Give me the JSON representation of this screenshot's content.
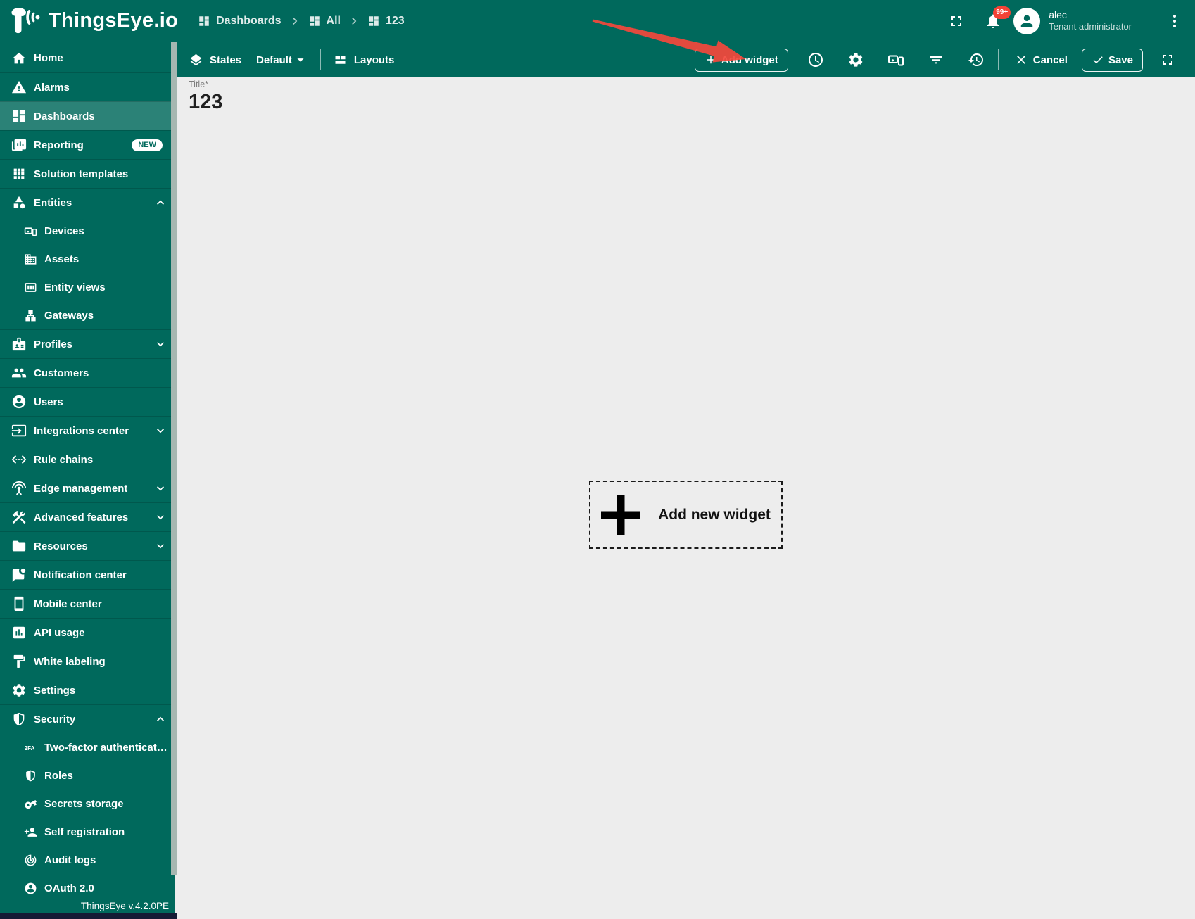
{
  "app": {
    "brand": "ThingsEye.io",
    "version_label": "ThingsEye v.4.2.0PE"
  },
  "colors": {
    "teal": "#00695c",
    "selected_row": "rgba(255,255,255,0.17)",
    "main_bg": "#ededed",
    "notification_badge_red": "#f44336",
    "annotation_arrow_red": "#f4483c",
    "scrollbar_thumb": "#a6b7b1",
    "bottom_strip": "#141b35"
  },
  "topbar": {
    "breadcrumb": [
      {
        "label": "Dashboards",
        "icon": "dashboards-icon"
      },
      {
        "label": "All",
        "icon": "dashboards-icon"
      },
      {
        "label": "123",
        "icon": "dashboards-icon"
      }
    ],
    "notifications_badge": "99+",
    "user": {
      "name": "alec",
      "role": "Tenant administrator"
    }
  },
  "toolbar": {
    "states_label": "States",
    "states_value": "Default",
    "layouts_label": "Layouts",
    "add_widget_label": "Add widget",
    "cancel_label": "Cancel",
    "save_label": "Save",
    "icon_buttons": [
      "time-window-icon",
      "settings-gear-icon",
      "entity-aliases-icon",
      "filter-icon",
      "version-history-icon"
    ]
  },
  "sidebar": {
    "items": [
      {
        "label": "Home",
        "icon": "home-icon",
        "level": "top"
      },
      {
        "label": "Alarms",
        "icon": "alarms-icon",
        "level": "top",
        "divider": true
      },
      {
        "label": "Dashboards",
        "icon": "dashboards-icon",
        "level": "top",
        "divider": true,
        "selected": true
      },
      {
        "label": "Reporting",
        "icon": "reporting-icon",
        "level": "top",
        "divider": true,
        "badge": "NEW"
      },
      {
        "label": "Solution templates",
        "icon": "solution-templates-icon",
        "level": "top",
        "divider": true
      },
      {
        "label": "Entities",
        "icon": "entities-icon",
        "level": "top",
        "divider": true,
        "chevron": "up"
      },
      {
        "label": "Devices",
        "icon": "devices-icon",
        "level": "sub"
      },
      {
        "label": "Assets",
        "icon": "assets-icon",
        "level": "sub"
      },
      {
        "label": "Entity views",
        "icon": "entity-views-icon",
        "level": "sub"
      },
      {
        "label": "Gateways",
        "icon": "gateways-icon",
        "level": "sub"
      },
      {
        "label": "Profiles",
        "icon": "profiles-icon",
        "level": "top",
        "divider": true,
        "chevron": "down"
      },
      {
        "label": "Customers",
        "icon": "customers-icon",
        "level": "top",
        "divider": true
      },
      {
        "label": "Users",
        "icon": "users-icon",
        "level": "top",
        "divider": true
      },
      {
        "label": "Integrations center",
        "icon": "integrations-center-icon",
        "level": "top",
        "divider": true,
        "chevron": "down"
      },
      {
        "label": "Rule chains",
        "icon": "rule-chains-icon",
        "level": "top",
        "divider": true
      },
      {
        "label": "Edge management",
        "icon": "edge-management-icon",
        "level": "top",
        "divider": true,
        "chevron": "down"
      },
      {
        "label": "Advanced features",
        "icon": "advanced-features-icon",
        "level": "top",
        "divider": true,
        "chevron": "down"
      },
      {
        "label": "Resources",
        "icon": "resources-icon",
        "level": "top",
        "divider": true,
        "chevron": "down"
      },
      {
        "label": "Notification center",
        "icon": "notification-center-icon",
        "level": "top",
        "divider": true
      },
      {
        "label": "Mobile center",
        "icon": "mobile-center-icon",
        "level": "top",
        "divider": true
      },
      {
        "label": "API usage",
        "icon": "api-usage-icon",
        "level": "top",
        "divider": true
      },
      {
        "label": "White labeling",
        "icon": "white-labeling-icon",
        "level": "top",
        "divider": true
      },
      {
        "label": "Settings",
        "icon": "settings-icon",
        "level": "top",
        "divider": true
      },
      {
        "label": "Security",
        "icon": "security-icon",
        "level": "top",
        "divider": true,
        "chevron": "up"
      },
      {
        "label": "Two-factor authenticati…",
        "icon": "two-factor-icon",
        "level": "sub"
      },
      {
        "label": "Roles",
        "icon": "roles-icon",
        "level": "sub"
      },
      {
        "label": "Secrets storage",
        "icon": "secrets-storage-icon",
        "level": "sub"
      },
      {
        "label": "Self registration",
        "icon": "self-registration-icon",
        "level": "sub"
      },
      {
        "label": "Audit logs",
        "icon": "audit-logs-icon",
        "level": "sub"
      },
      {
        "label": "OAuth 2.0",
        "icon": "oauth-icon",
        "level": "sub"
      }
    ]
  },
  "main": {
    "title_label": "Title*",
    "title_value": "123",
    "add_widget_cta": "Add new widget"
  }
}
